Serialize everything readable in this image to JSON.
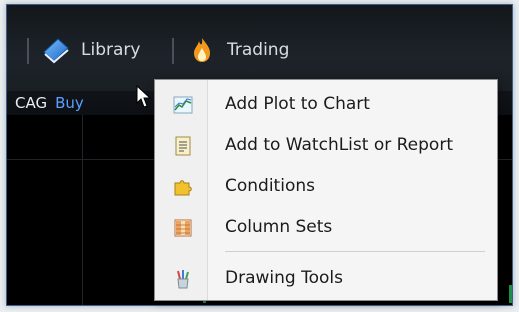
{
  "toolbar": {
    "library_label": "Library",
    "trading_label": "Trading"
  },
  "symbol_bar": {
    "symbol": "CAG",
    "side": "Buy"
  },
  "context_menu": {
    "items": [
      {
        "label": "Add Plot to Chart",
        "icon": "chart-plot-icon"
      },
      {
        "label": "Add to WatchList or Report",
        "icon": "watchlist-report-icon"
      },
      {
        "label": "Conditions",
        "icon": "puzzle-piece-icon"
      },
      {
        "label": "Column Sets",
        "icon": "column-grid-icon"
      },
      {
        "label": "Drawing Tools",
        "icon": "pencil-cup-icon"
      }
    ]
  },
  "colors": {
    "background": "#0b0d10",
    "menu_bg": "#f5f5f5",
    "buy_blue": "#5aa0ff",
    "accent_orange": "#f39a1e"
  }
}
